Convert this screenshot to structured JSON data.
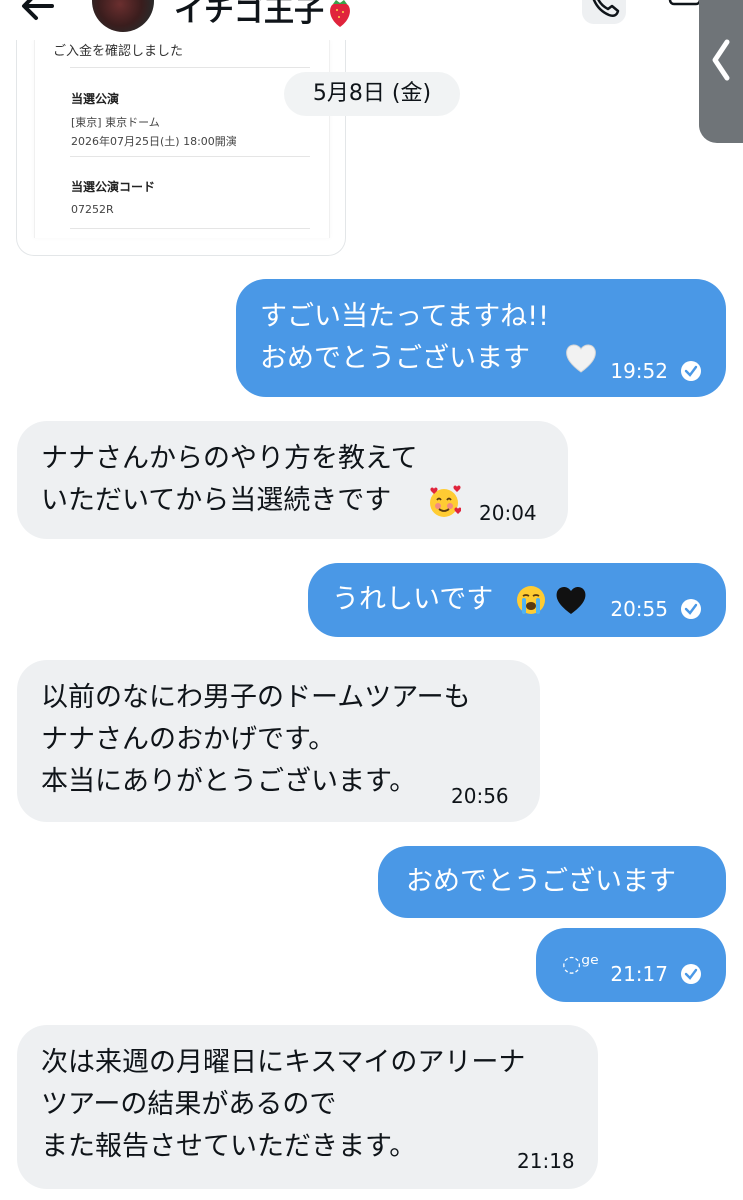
{
  "header": {
    "title": "イチゴ王子"
  },
  "card": {
    "top_text": "ご入金を確認しました",
    "fields": [
      {
        "label": "当選公演",
        "lines": [
          "[東京] 東京ドーム",
          "2026年07月25日(土) 18:00開演"
        ]
      },
      {
        "label": "当選公演コード",
        "lines": [
          "07252R"
        ]
      }
    ]
  },
  "date_separator": "5月8日 (金)",
  "messages": [
    {
      "direction": "sent",
      "text": "すごい当たってますね!!\nおめでとうございます",
      "emoji": "white-heart",
      "time": "19:52",
      "read": true
    },
    {
      "direction": "received",
      "text": "ナナさんからのやり方を教えて\nいただいてから当選続きです",
      "emoji": "smiling-face-with-hearts",
      "time": "20:04"
    },
    {
      "direction": "sent",
      "text": "うれしいです",
      "emoji": "loudly-crying-face+black-heart",
      "time": "20:55",
      "read": true
    },
    {
      "direction": "received",
      "text": "以前のなにわ男子のドームツアーも\nナナさんのおかげです。\n本当にありがとうございます。",
      "time": "20:56"
    },
    {
      "direction": "sent",
      "text": "おめでとうございます"
    },
    {
      "direction": "sent",
      "text": "◌ᵍᵉ",
      "time": "21:17",
      "read": true
    },
    {
      "direction": "received",
      "text": "次は来週の月曜日にキスマイのアリーナ\nツアーの結果があるので\nまた報告させていただきます。",
      "time": "21:18"
    }
  ],
  "colors": {
    "sent_bubble": "#4a98e6",
    "received_bubble": "#eef0f2",
    "side_tab": "#6f7478"
  }
}
